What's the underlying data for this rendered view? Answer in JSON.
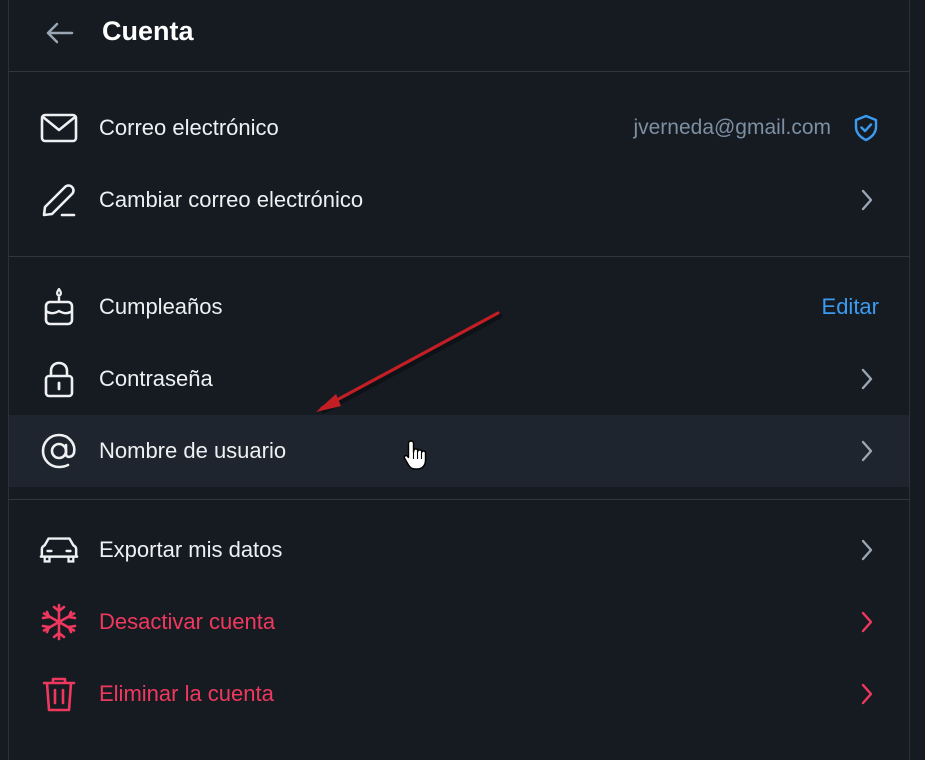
{
  "header": {
    "title": "Cuenta",
    "back_icon": "arrow-left-icon"
  },
  "sections": [
    {
      "rows": [
        {
          "label": "Correo electrónico",
          "value": "jverneda@gmail.com",
          "icon": "mail-icon",
          "trailing": "shield-check-icon"
        },
        {
          "label": "Cambiar correo electrónico",
          "icon": "pencil-icon",
          "trailing": "chevron-right-icon"
        }
      ]
    },
    {
      "rows": [
        {
          "label": "Cumpleaños",
          "action": "Editar",
          "icon": "cake-icon"
        },
        {
          "label": "Contraseña",
          "icon": "lock-icon",
          "trailing": "chevron-right-icon"
        },
        {
          "label": "Nombre de usuario",
          "icon": "at-sign-icon",
          "trailing": "chevron-right-icon",
          "state": "hovered"
        }
      ]
    },
    {
      "rows": [
        {
          "label": "Exportar mis datos",
          "icon": "car-icon",
          "trailing": "chevron-right-icon"
        },
        {
          "label": "Desactivar cuenta",
          "icon": "snowflake-icon",
          "trailing": "chevron-right-icon",
          "danger": true
        },
        {
          "label": "Eliminar la cuenta",
          "icon": "trash-icon",
          "trailing": "chevron-right-icon",
          "danger": true
        }
      ]
    }
  ],
  "colors": {
    "background": "#161b22",
    "text": "#eef0f2",
    "muted": "#7d8fa3",
    "accent": "#3a9bf0",
    "danger": "#f0385e",
    "annotation_arrow": "#c41e25"
  }
}
